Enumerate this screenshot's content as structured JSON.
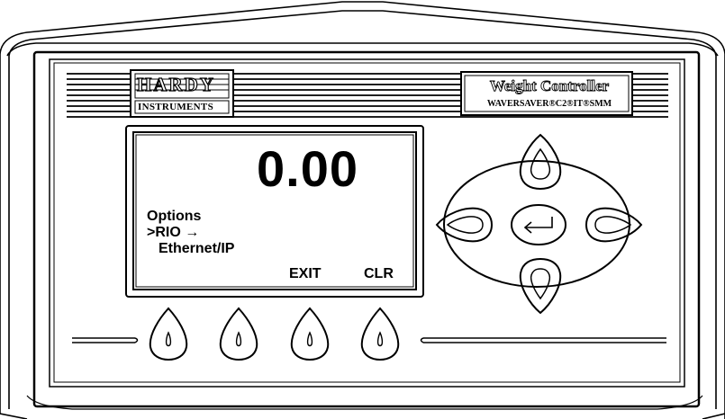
{
  "brand": {
    "name": "HARDY",
    "subtitle": "INSTRUMENTS"
  },
  "product": {
    "title": "Weight Controller",
    "subtitle": "WAVERSAVER®C2®IT®SMM"
  },
  "display": {
    "value": "0.00",
    "lines": [
      "Options",
      ">RIO →",
      "Ethernet/IP"
    ],
    "softkeys": [
      "EXIT",
      "CLR"
    ]
  },
  "icons": {
    "nav_up": "arrow-up-icon",
    "nav_down": "arrow-down-icon",
    "nav_left": "arrow-left-icon",
    "nav_right": "arrow-right-icon",
    "enter": "enter-return-icon",
    "softkey": "droplet-key-icon"
  }
}
